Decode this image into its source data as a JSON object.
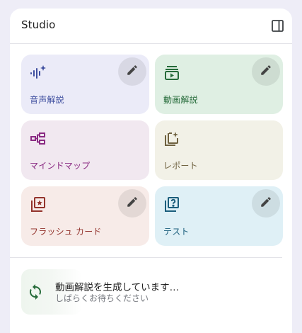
{
  "panel": {
    "title": "Studio",
    "toggle_icon": "side-panel-icon"
  },
  "cards": [
    {
      "id": "audio",
      "label": "音声解説",
      "icon": "audio-sparkle-icon",
      "bg": "#ebebf8",
      "color": "#3f4f9f",
      "editable": true
    },
    {
      "id": "video",
      "label": "動画解説",
      "icon": "video-playlist-icon",
      "bg": "#dfefe3",
      "color": "#266b3a",
      "editable": true
    },
    {
      "id": "mindmap",
      "label": "マインドマップ",
      "icon": "mindmap-icon",
      "bg": "#f1e8f0",
      "color": "#8a2a82",
      "editable": false
    },
    {
      "id": "report",
      "label": "レポート",
      "icon": "report-sparkle-icon",
      "bg": "#f2f1e7",
      "color": "#6f6240",
      "editable": false
    },
    {
      "id": "flashcards",
      "label": "フラッシュ カード",
      "icon": "flashcard-star-icon",
      "bg": "#f7ebe8",
      "color": "#93332c",
      "editable": true
    },
    {
      "id": "quiz",
      "label": "テスト",
      "icon": "quiz-question-icon",
      "bg": "#dff0f6",
      "color": "#1b5e7c",
      "editable": true
    }
  ],
  "progress": {
    "title": "動画解説を生成しています…",
    "subtitle": "しばらくお待ちください",
    "icon": "sync-icon",
    "color": "#266b3a"
  }
}
